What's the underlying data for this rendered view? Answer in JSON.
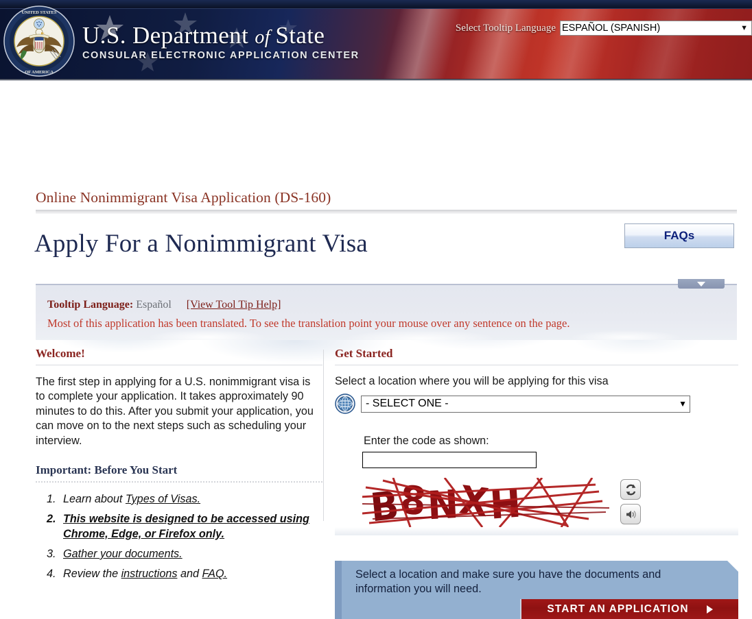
{
  "header": {
    "seal_icon": "dept-of-state-seal",
    "title_line1_part1": "U.S. ",
    "title_line1_part2": "Department ",
    "title_line1_of": "of ",
    "title_line1_part3": "State",
    "subtitle": "CONSULAR ELECTRONIC APPLICATION CENTER",
    "language_label": "Select Tooltip Language",
    "language_value": "ESPAÑOL (SPANISH)"
  },
  "page": {
    "subtitle": "Online Nonimmigrant Visa Application (DS-160)",
    "heading": "Apply For a Nonimmigrant Visa",
    "faq_button": "FAQs"
  },
  "tooltip_panel": {
    "label": "Tooltip Language:",
    "value": "Español",
    "help_link": "[View Tool Tip Help]",
    "notice": "Most of this application has been translated. To see the translation point your mouse over any sentence on the page."
  },
  "welcome": {
    "heading": "Welcome!",
    "body": "The first step in applying for a U.S. nonimmigrant visa is to complete your application. It takes approximately 90 minutes to do this. After you submit your application, you can move on to the next steps such as scheduling your interview.",
    "important_heading": "Important: Before You Start",
    "items": [
      {
        "prefix": "Learn about ",
        "link": "Types of Visas.",
        "suffix": "",
        "strong": false
      },
      {
        "prefix": "",
        "link": "This website is designed to be accessed using Chrome, Edge, or Firefox only.",
        "suffix": "",
        "strong": true
      },
      {
        "prefix": "",
        "link": "Gather your documents.",
        "suffix": "",
        "strong": false
      },
      {
        "prefix": "Review the ",
        "link": "instructions",
        "mid": " and ",
        "link2": "FAQ.",
        "suffix": "",
        "strong": false
      }
    ]
  },
  "get_started": {
    "heading": "Get Started",
    "location_label": "Select a location where you will be applying for this visa",
    "location_value": "- SELECT ONE -",
    "globe_icon": "globe-icon",
    "code_label": "Enter the code as shown:",
    "code_value": "",
    "captcha_text": "B8NXH",
    "refresh_icon": "refresh-icon",
    "audio_icon": "audio-speaker-icon"
  },
  "start_panel": {
    "text": "Select a location and make sure you have the documents and information you will need.",
    "button_label": "START AN APPLICATION",
    "arrow_icon": "arrow-right-icon"
  },
  "colors": {
    "header_red": "#a82420",
    "header_navy": "#0d1730",
    "heading_navy": "#1f2a52",
    "maroon": "#8a3324",
    "notice_red": "#c0392b",
    "panel_blue": "#93b0d0",
    "start_button_red": "#8f1212",
    "faq_text": "#0b1f7a"
  }
}
